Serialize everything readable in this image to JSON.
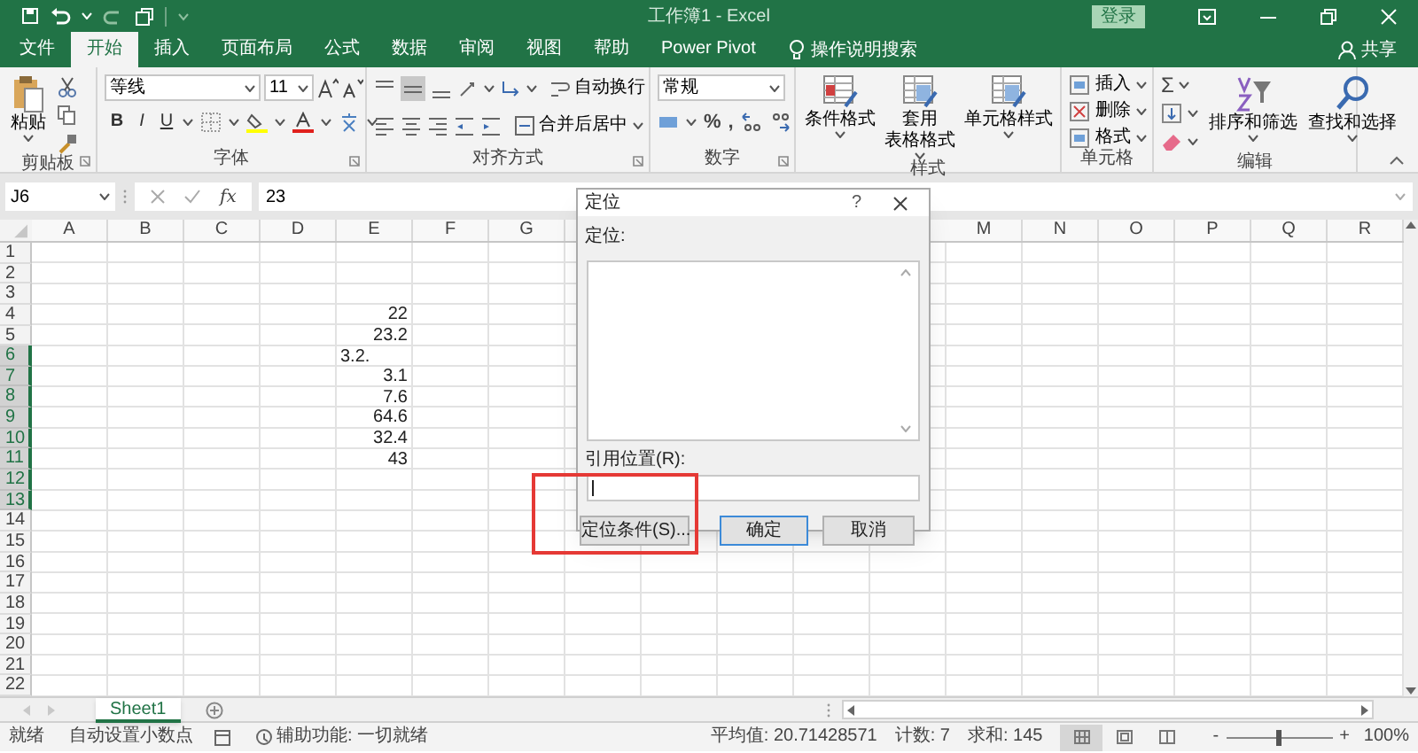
{
  "window": {
    "title": "工作簿1 - Excel",
    "login": "登录"
  },
  "tabs": [
    {
      "label": "文件",
      "selected": false
    },
    {
      "label": "开始",
      "selected": true
    },
    {
      "label": "插入",
      "selected": false
    },
    {
      "label": "页面布局",
      "selected": false
    },
    {
      "label": "公式",
      "selected": false
    },
    {
      "label": "数据",
      "selected": false
    },
    {
      "label": "审阅",
      "selected": false
    },
    {
      "label": "视图",
      "selected": false
    },
    {
      "label": "帮助",
      "selected": false
    },
    {
      "label": "Power Pivot",
      "selected": false
    }
  ],
  "tell_me": "操作说明搜索",
  "share": "共享",
  "ribbon": {
    "groups": [
      {
        "kind": "clipboard",
        "label": "剪贴板",
        "paste": "粘贴"
      },
      {
        "kind": "font",
        "label": "字体",
        "font": "等线",
        "size": "11",
        "style_buttons": [
          "B",
          "I",
          "U"
        ]
      },
      {
        "kind": "alignment",
        "label": "对齐方式",
        "wrap": "自动换行",
        "merge": "合并后居中"
      },
      {
        "kind": "number",
        "label": "数字",
        "format": "常规",
        "symbols": [
          "%",
          ","
        ]
      },
      {
        "kind": "styles",
        "label": "样式",
        "buttons": [
          {
            "lines": [
              "条件格式"
            ]
          },
          {
            "lines": [
              "套用",
              "表格格式"
            ]
          },
          {
            "lines": [
              "单元格样式"
            ]
          }
        ]
      },
      {
        "kind": "cells",
        "label": "单元格",
        "buttons": [
          "插入",
          "删除",
          "格式"
        ]
      },
      {
        "kind": "editing",
        "label": "编辑",
        "sum": "Σ",
        "buttons": [
          "排序和筛选",
          "查找和选择"
        ]
      }
    ]
  },
  "formula_bar": {
    "name_box": "J6",
    "function_glyph": "fx",
    "value": "23"
  },
  "sheet": {
    "columns_left": [
      "A",
      "B",
      "C",
      "D",
      "E",
      "F",
      "G"
    ],
    "columns_right": [
      "M",
      "N",
      "O",
      "P",
      "Q",
      "R"
    ],
    "rows": [
      {
        "label": "1",
        "selected": false
      },
      {
        "label": "2",
        "selected": false
      },
      {
        "label": "3",
        "selected": false
      },
      {
        "label": "4",
        "selected": false,
        "E": "22"
      },
      {
        "label": "5",
        "selected": false,
        "E": "23.2"
      },
      {
        "label": "6",
        "selected": true,
        "E": "3.2."
      },
      {
        "label": "7",
        "selected": true,
        "E": "3.1"
      },
      {
        "label": "8",
        "selected": true,
        "E": "7.6"
      },
      {
        "label": "9",
        "selected": true,
        "E": "64.6"
      },
      {
        "label": "10",
        "selected": true,
        "E": "32.4"
      },
      {
        "label": "11",
        "selected": true,
        "E": "43"
      },
      {
        "label": "12",
        "selected": true
      },
      {
        "label": "13",
        "selected": true
      },
      {
        "label": "14",
        "selected": false
      },
      {
        "label": "15",
        "selected": false
      },
      {
        "label": "16",
        "selected": false
      },
      {
        "label": "17",
        "selected": false
      },
      {
        "label": "18",
        "selected": false
      },
      {
        "label": "19",
        "selected": false
      },
      {
        "label": "20",
        "selected": false
      },
      {
        "label": "21",
        "selected": false
      },
      {
        "label": "22",
        "selected": false
      }
    ]
  },
  "sheet_tabs": [
    {
      "label": "Sheet1",
      "selected": true
    }
  ],
  "dialog": {
    "title": "定位",
    "help": "?",
    "list_label": "定位:",
    "reference_label": "引用位置(R):",
    "buttons": [
      {
        "label": "定位条件(S)...",
        "default": false
      },
      {
        "label": "确定",
        "default": true
      },
      {
        "label": "取消",
        "default": false
      }
    ]
  },
  "status_bar": {
    "ready": "就绪",
    "auto_decimal": "自动设置小数点",
    "accessibility": "辅助功能: 一切就绪",
    "average": "平均值: 20.71428571",
    "count": "计数: 7",
    "sum": "求和: 145",
    "view_buttons": [
      {
        "selected": true
      },
      {
        "selected": false
      },
      {
        "selected": false
      }
    ],
    "zoom_minus": "-",
    "zoom_plus": "+",
    "zoom": {
      "level": 0.5
    },
    "zoom_label": "100%"
  }
}
